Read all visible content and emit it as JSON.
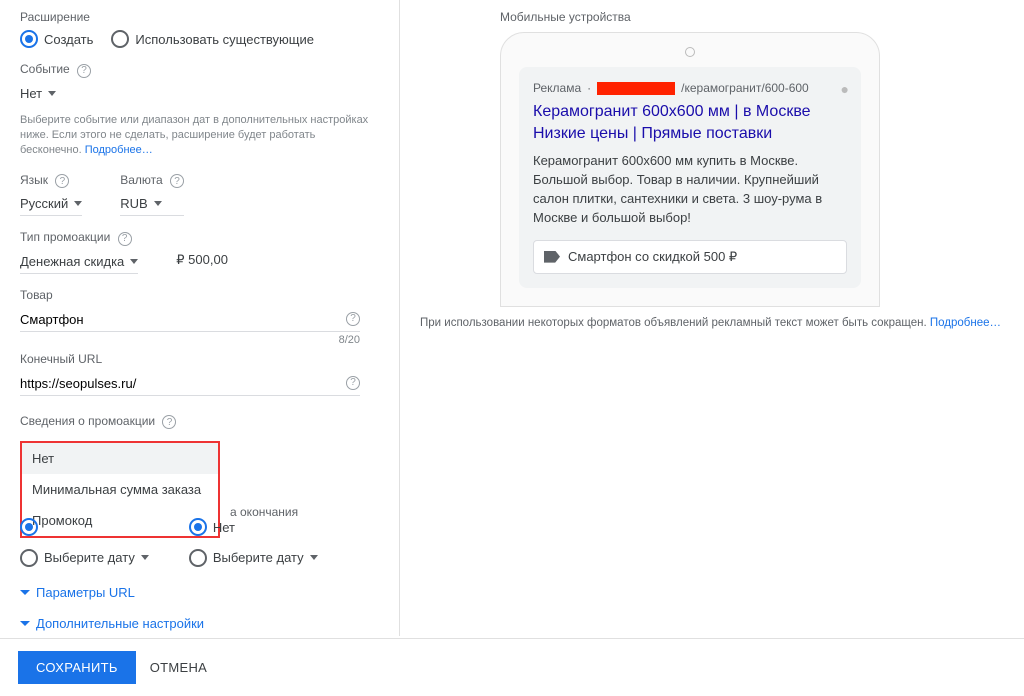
{
  "left": {
    "extension_label": "Расширение",
    "radio_create": "Создать",
    "radio_existing": "Использовать существующие",
    "event_label": "Событие",
    "event_value": "Нет",
    "hint_text": "Выберите событие или диапазон дат в дополнительных настройках ниже. Если этого не сделать, расширение будет работать бесконечно. ",
    "hint_link": "Подробнее…",
    "language_label": "Язык",
    "language_value": "Русский",
    "currency_label": "Валюта",
    "currency_value": "RUB",
    "promo_type_label": "Тип промоакции",
    "promo_type_value": "Денежная скидка",
    "promo_amount": "₽ 500,00",
    "product_label": "Товар",
    "product_value": "Смартфон",
    "product_counter": "8/20",
    "final_url_label": "Конечный URL",
    "final_url_value": "https://seopulses.ru/",
    "promo_details_label": "Сведения о промоакции",
    "promo_options": [
      "Нет",
      "Минимальная сумма заказа",
      "Промокод"
    ],
    "end_label": "а окончания",
    "no_value": "Нет",
    "select_date": "Выберите дату",
    "url_params": "Параметры URL",
    "advanced": "Дополнительные настройки"
  },
  "right": {
    "preview_label": "Мобильные устройства",
    "ad_label": "Реклама",
    "ad_url_suffix": "/керамогранит/600-600",
    "ad_title": "Керамогранит 600х600 мм | в Москве Низкие цены | Прямые поставки",
    "ad_desc": "Керамогранит 600х600 мм купить в Москве. Большой выбор. Товар в наличии. Крупнейший салон плитки, сантехники и света. 3 шоу-рума в Москве и большой выбор!",
    "ad_ext": "Смартфон со скидкой 500 ₽",
    "disclaimer_text": "При использовании некоторых форматов объявлений рекламный текст может быть сокращен. ",
    "disclaimer_link": "Подробнее…"
  },
  "footer": {
    "save": "СОХРАНИТЬ",
    "cancel": "ОТМЕНА"
  }
}
